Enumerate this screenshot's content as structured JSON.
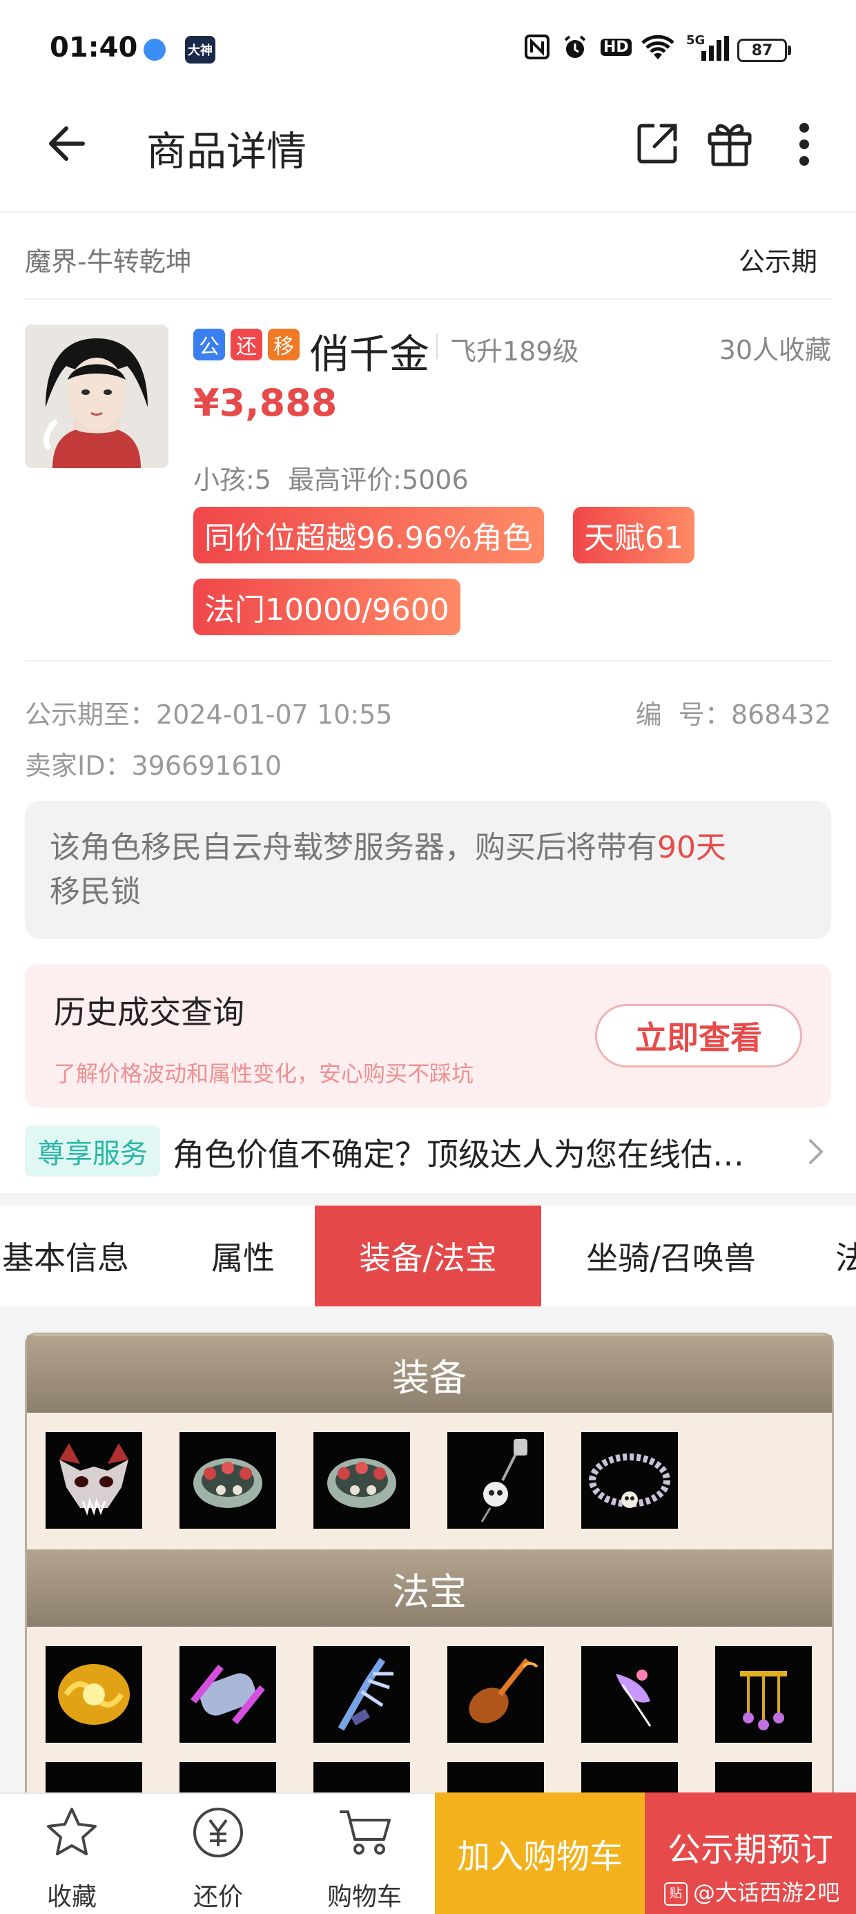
{
  "status_bar": {
    "time": "01:40",
    "app_icon_label": "大神",
    "battery": "87",
    "network": "5G",
    "hd": "HD"
  },
  "header": {
    "title": "商品详情"
  },
  "listing": {
    "server": "魔界-牛转乾坤",
    "status": "公示期",
    "badges": [
      {
        "label": "公",
        "color": "#3a7ff0"
      },
      {
        "label": "还",
        "color": "#f0474a"
      },
      {
        "label": "移",
        "color": "#f07a24"
      }
    ],
    "character_name": "俏千金",
    "level": "飞升189级",
    "favorites": "30人收藏",
    "price": "¥3,888",
    "sub_info": "小孩:5  最高评价:5006",
    "tags": [
      "同价位超越96.96%角色",
      "天赋61",
      "法门10000/9600"
    ],
    "public_until_label": "公示期至：",
    "public_until": "2024-01-07 10:55",
    "serial_label": "编  号：",
    "serial": "868432",
    "seller_label": "卖家ID：",
    "seller_id": "396691610"
  },
  "notice": {
    "text_before": "该角色移民自云舟载梦服务器，购买后将带有",
    "highlight": "90天",
    "text_after": "移民锁"
  },
  "history": {
    "title": "历史成交查询",
    "subtitle": "了解价格波动和属性变化，安心购买不踩坑",
    "button": "立即查看"
  },
  "service": {
    "badge": "尊享服务",
    "text": "角色价值不确定？顶级达人为您在线估…"
  },
  "tabs": [
    {
      "label": "基本信息",
      "active": false
    },
    {
      "label": "属性",
      "active": false
    },
    {
      "label": "装备/法宝",
      "active": true
    },
    {
      "label": "坐骑/召唤兽",
      "active": false
    },
    {
      "label": "法",
      "active": false
    }
  ],
  "equipment": {
    "equip_title": "装备",
    "treasure_title": "法宝",
    "equip_items": [
      "demon-mask",
      "skull-ring",
      "skull-ring",
      "skull-pendant",
      "skull-bracelet"
    ],
    "treasure_items": [
      "gold-orb",
      "purple-scroll",
      "blue-claw",
      "fire-lute",
      "pink-feather",
      "gold-chime"
    ]
  },
  "bottom_bar": {
    "favorite": "收藏",
    "bargain": "还价",
    "cart": "购物车",
    "add_to_cart": "加入购物车",
    "reserve": "公示期预订",
    "watermark": "@大话西游2吧"
  },
  "colors": {
    "accent": "#e74a4a",
    "cart_button": "#f3b21c"
  }
}
